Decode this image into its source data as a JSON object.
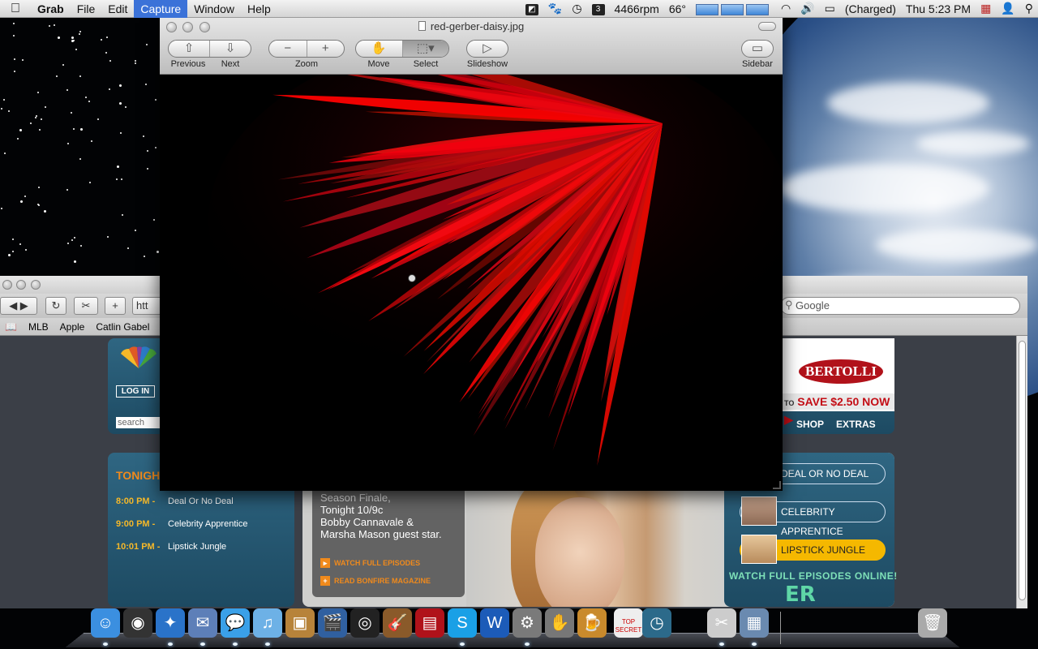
{
  "menubar": {
    "app_name": "Grab",
    "menus": [
      "File",
      "Edit",
      "Capture",
      "Window",
      "Help"
    ],
    "active_menu": "Capture",
    "status": {
      "fan_speed": "4466rpm",
      "temperature": "66°",
      "battery": "(Charged)",
      "clock": "Thu 5:23 PM"
    }
  },
  "preview": {
    "title": "red-gerber-daisy.jpg",
    "toolbar": {
      "previous": "Previous",
      "next": "Next",
      "zoom": "Zoom",
      "move": "Move",
      "select": "Select",
      "slideshow": "Slideshow",
      "sidebar": "Sidebar"
    },
    "image_subject": "red gerber daisy petals on black background"
  },
  "safari": {
    "url_fragment": "htt",
    "search_placeholder": "Google",
    "bookmarks": [
      "MLB",
      "Apple",
      "Catlin Gabel"
    ]
  },
  "nbc": {
    "login": "LOG IN",
    "search_placeholder": "search",
    "tonight_title": "TONIGHT",
    "schedule": [
      {
        "time": "8:00 PM -",
        "show": "Deal Or No Deal"
      },
      {
        "time": "9:00 PM -",
        "show": "Celebrity Apprentice"
      },
      {
        "time": "10:01 PM -",
        "show": "Lipstick Jungle"
      }
    ],
    "promo": {
      "line1": "Season Finale,",
      "line2": "Tonight 10/9c",
      "line3": "Bobby Cannavale &",
      "line4": "Marsha Mason guest star.",
      "link1": "WATCH FULL EPISODES",
      "link2": "READ BONFIRE MAGAZINE"
    },
    "shows": [
      "DEAL OR NO DEAL",
      "CELEBRITY APPRENTICE",
      "LIPSTICK JUNGLE"
    ],
    "watch_full": "WATCH FULL EPISODES ONLINE!",
    "er_logo": "ER",
    "ad": {
      "brand": "BERTOLLI",
      "to": "TO",
      "save": "SAVE $2.50 NOW",
      "arrow": "▶"
    },
    "nav": [
      "SHOP",
      "EXTRAS"
    ]
  },
  "dock": {
    "apps": [
      "Finder",
      "Dashboard",
      "Safari",
      "Mail",
      "iChat",
      "iTunes",
      "iPhoto",
      "iMovie",
      "DVD Player",
      "GarageBand",
      "Photo Booth",
      "Skype",
      "Word",
      "System Preferences",
      "Growl",
      "Beer",
      "Top Secret",
      "Time Machine",
      "Grab",
      "Preview",
      "Trash"
    ],
    "top_secret_label": "TOP SECRET"
  },
  "colors": {
    "accent_menu": "#3b72d8",
    "nbc_orange": "#f08a1c",
    "nbc_yellow": "#f5b829",
    "bertolli_red": "#b1121a"
  }
}
